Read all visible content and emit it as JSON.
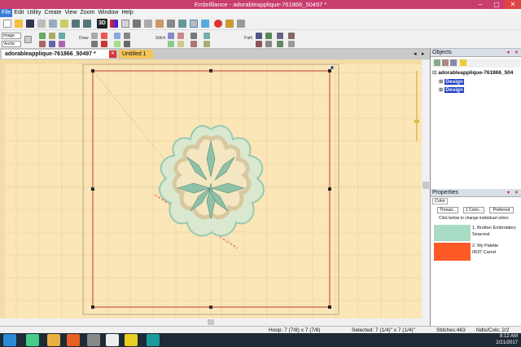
{
  "window": {
    "title": "Embrilliance - adorableapplique-761866_50497 *",
    "minimize": "–",
    "maximize": "▢",
    "close": "✕"
  },
  "menu": [
    "File",
    "Edit",
    "Utility",
    "Create",
    "View",
    "Zoom",
    "Window",
    "Help"
  ],
  "toolbar": {
    "image_label": "Image",
    "vector_label": "Vector",
    "draw_label": "Draw",
    "stitch_label": "Stitch",
    "path_label": "Path",
    "view3d_label": "3D"
  },
  "tabs": [
    {
      "label": "adorableapplique-761866_50497 *",
      "active": true
    },
    {
      "label": "Untitled 1 *",
      "active": false
    }
  ],
  "objects": {
    "header": "Objects",
    "root": "adorableapplique-761866_504",
    "children": [
      "Design",
      "Design"
    ]
  },
  "properties": {
    "header": "Properties",
    "tab": "Color",
    "buttons": [
      "Thread...",
      "1 Color...",
      "Preferred"
    ],
    "hint": "Click below to change individual colors",
    "colors": [
      {
        "line1": "1. Brother Embroidery",
        "line2": "Seacrest",
        "swatch": "#a9dcc4"
      },
      {
        "line1": "2. My Palette",
        "line2": "0637 Carrot",
        "swatch": "#fe5a28"
      }
    ]
  },
  "status": {
    "hoop": "Hoop: 7 (7/8) x 7 (7/8)",
    "selected": "Selected: 7 (1/4)\" x 7 (1/4)\"",
    "stitches": "Stitches:463",
    "ndls": "Ndls/Cols: 2/2"
  },
  "taskbar": {
    "time": "8:12 AM",
    "date": "2/21/2017"
  },
  "colors": {
    "title": "#c83c6e",
    "canvas": "#fbe6b8",
    "hoop_line": "#c0392b",
    "taskbar": "#1e2a35"
  }
}
